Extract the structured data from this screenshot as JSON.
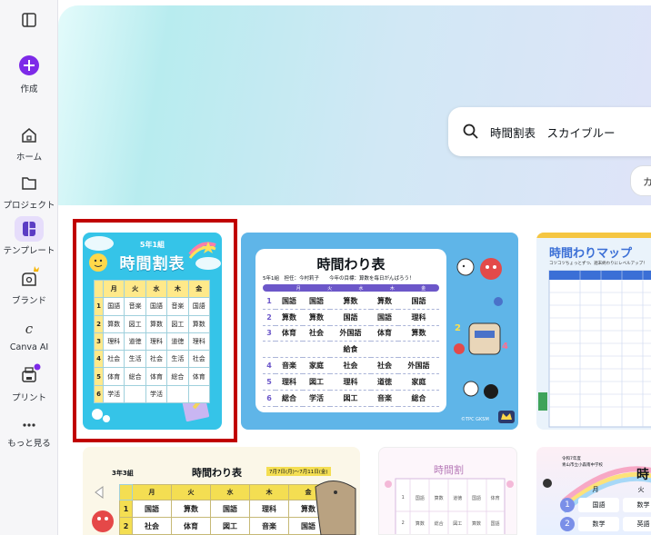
{
  "sidebar": {
    "items": [
      {
        "label": ""
      },
      {
        "label": "作成"
      },
      {
        "label": "ホーム"
      },
      {
        "label": "プロジェクト"
      },
      {
        "label": "テンプレート"
      },
      {
        "label": "ブランド"
      },
      {
        "label": "Canva AI"
      },
      {
        "label": "プリント"
      },
      {
        "label": "もっと見る"
      }
    ]
  },
  "search": {
    "query": "時間割表　スカイブルー"
  },
  "chip": {
    "label": "カ"
  },
  "templates": {
    "t1": {
      "grade": "5年1組",
      "title": "時間割表",
      "days": [
        "月",
        "火",
        "水",
        "木",
        "金"
      ],
      "rows": [
        [
          "1",
          "国語",
          "音楽",
          "国語",
          "音楽",
          "国語"
        ],
        [
          "2",
          "算数",
          "図工",
          "算数",
          "図工",
          "算数"
        ],
        [
          "3",
          "理科",
          "道徳",
          "理科",
          "道徳",
          "理科"
        ],
        [
          "4",
          "社会",
          "生活",
          "社会",
          "生活",
          "社会"
        ],
        [
          "5",
          "体育",
          "総合",
          "体育",
          "総合",
          "体育"
        ],
        [
          "6",
          "学活",
          "",
          "学活",
          "",
          ""
        ]
      ]
    },
    "t2": {
      "title": "時間わり表",
      "info": "5年1組　担任：今村莉子　　今年の目標：算数を毎日がんばろう！",
      "days": [
        "月",
        "火",
        "水",
        "木",
        "金"
      ],
      "rows": [
        [
          "1",
          "国語",
          "国語",
          "算数",
          "算数",
          "国語"
        ],
        [
          "2",
          "算数",
          "算数",
          "国語",
          "国語",
          "理科"
        ],
        [
          "3",
          "体育",
          "社会",
          "外国語",
          "体育",
          "算数"
        ],
        [
          "",
          "",
          "",
          "給食",
          "",
          ""
        ],
        [
          "4",
          "音楽",
          "家庭",
          "社会",
          "社会",
          "外国語"
        ],
        [
          "5",
          "理科",
          "図工",
          "理科",
          "道徳",
          "家庭"
        ],
        [
          "6",
          "総合",
          "学活",
          "図工",
          "音楽",
          "総合"
        ]
      ],
      "credit": "©TPC GKSM"
    },
    "t3": {
      "title": "時間わりマップ",
      "subtitle": "コツコツちょっとずつ、週末終わりにレベルアップ！"
    },
    "t4": {
      "class": "3年3組",
      "title": "時間わり表",
      "date": "7月7日(月)～7月11日(金)",
      "days": [
        "月",
        "火",
        "水",
        "木",
        "金"
      ],
      "rows": [
        [
          "1",
          "国語",
          "算数",
          "国語",
          "理科",
          "算数"
        ],
        [
          "2",
          "社会",
          "体育",
          "図工",
          "音楽",
          "国語"
        ]
      ]
    },
    "t5": {
      "title": "時間割",
      "row1": [
        "1",
        "国語",
        "算数",
        "道徳",
        "国語",
        "体育"
      ],
      "row2": [
        "2",
        "算数",
        "総合",
        "図工",
        "算数",
        "国語"
      ]
    },
    "t6": {
      "school": "令和7年度",
      "school2": "青山市立小森南中学校",
      "title": "時",
      "days": [
        "月",
        "火"
      ],
      "row1": [
        "1",
        "国語",
        "数学"
      ],
      "row2": [
        "2",
        "数学",
        "英語"
      ]
    }
  },
  "colors": {
    "selection": "#c00000",
    "canva_purple": "#7d2ae8",
    "accent_sky": "#35c4e8"
  }
}
